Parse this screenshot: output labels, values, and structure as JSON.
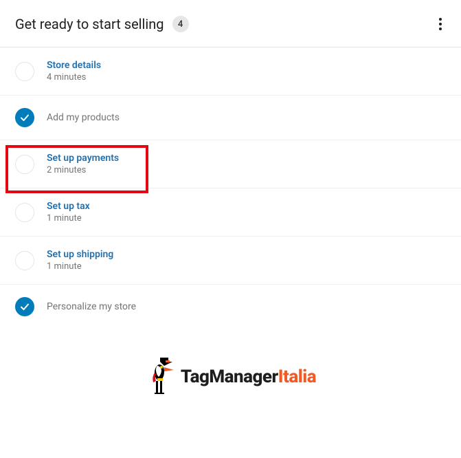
{
  "header": {
    "title": "Get ready to start selling",
    "count": "4"
  },
  "tasks": [
    {
      "title": "Store details",
      "sub": "4 minutes",
      "completed": false,
      "link": true
    },
    {
      "title": "Add my products",
      "sub": "",
      "completed": true,
      "link": false
    },
    {
      "title": "Set up payments",
      "sub": "2 minutes",
      "completed": false,
      "link": true,
      "highlighted": true
    },
    {
      "title": "Set up tax",
      "sub": "1 minute",
      "completed": false,
      "link": true
    },
    {
      "title": "Set up shipping",
      "sub": "1 minute",
      "completed": false,
      "link": true
    },
    {
      "title": "Personalize my store",
      "sub": "",
      "completed": true,
      "link": false
    }
  ],
  "logo": {
    "part1": "TagManager",
    "part2": "Italia"
  }
}
